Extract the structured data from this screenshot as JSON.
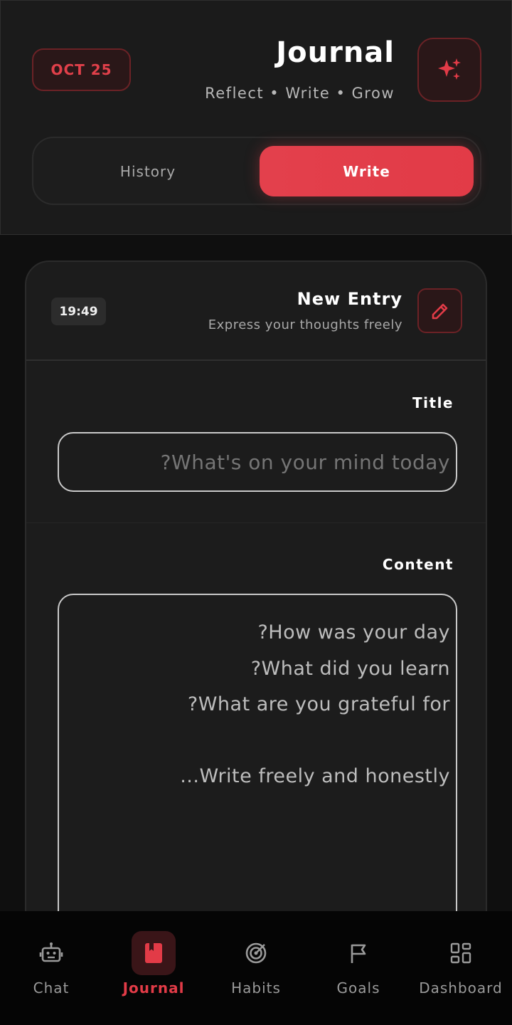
{
  "colors": {
    "accent": "#e23b47",
    "background": "#0f0f0f",
    "surface": "#1c1c1c"
  },
  "header": {
    "date": "OCT 25",
    "title": "Journal",
    "subtitle": "Reflect • Write • Grow",
    "magic_icon": "sparkles-icon",
    "tabs": {
      "history": "History",
      "write": "Write"
    },
    "active_tab": "Write"
  },
  "entry": {
    "time": "19:49",
    "title": "New Entry",
    "subtitle": "Express your thoughts freely",
    "edit_icon": "pencil-icon",
    "title_field": {
      "label": "Title",
      "placeholder": "?What's on your mind today",
      "value": ""
    },
    "content_field": {
      "label": "Content",
      "placeholder_lines": [
        "?How was your day",
        "?What did you learn",
        "?What are you grateful for",
        "",
        "...Write freely and honestly"
      ]
    }
  },
  "nav": {
    "items": [
      {
        "label": "Chat",
        "icon": "robot-icon"
      },
      {
        "label": "Journal",
        "icon": "book-icon"
      },
      {
        "label": "Habits",
        "icon": "target-icon"
      },
      {
        "label": "Goals",
        "icon": "flag-icon"
      },
      {
        "label": "Dashboard",
        "icon": "dashboard-grid-icon"
      }
    ],
    "active": "Journal"
  }
}
